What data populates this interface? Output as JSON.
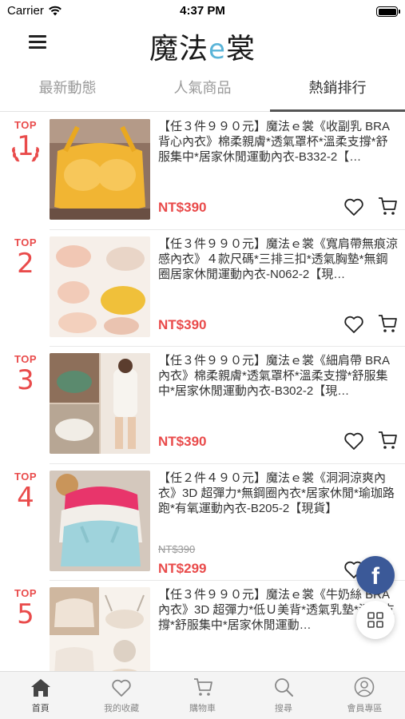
{
  "status_bar": {
    "carrier": "Carrier",
    "time": "4:37 PM"
  },
  "header": {
    "logo_left": "魔法",
    "logo_e": "e",
    "logo_right": "裳"
  },
  "tabs": [
    {
      "label": "最新動態",
      "active": false
    },
    {
      "label": "人氣商品",
      "active": false
    },
    {
      "label": "熱銷排行",
      "active": true
    }
  ],
  "products": [
    {
      "rank_label": "TOP",
      "rank": "1",
      "title": "【任３件９９０元】魔法ｅ裳《收副乳 BRA 背心內衣》棉柔親膚*透氣罩杯*溫柔支撐*舒服集中*居家休閒運動內衣-B332-2【…",
      "price": "NT$390",
      "old_price": ""
    },
    {
      "rank_label": "TOP",
      "rank": "2",
      "title": "【任３件９９０元】魔法ｅ裳《寬肩帶無痕涼感內衣》４款尺碼*三排三扣*透氣胸墊*無鋼圈居家休閒運動內衣-N062-2【現…",
      "price": "NT$390",
      "old_price": ""
    },
    {
      "rank_label": "TOP",
      "rank": "3",
      "title": "【任３件９９０元】魔法ｅ裳《細肩帶 BRA 內衣》棉柔親膚*透氣罩杯*溫柔支撐*舒服集中*居家休閒運動內衣-B302-2【現…",
      "price": "NT$390",
      "old_price": ""
    },
    {
      "rank_label": "TOP",
      "rank": "4",
      "title": "【任２件４９０元】魔法ｅ裳《洞洞涼爽內衣》3D 超彈力*無鋼圈內衣*居家休閒*瑜珈路跑*有氧運動內衣-B205-2【現貨】",
      "price": "NT$299",
      "old_price": "NT$390"
    },
    {
      "rank_label": "TOP",
      "rank": "5",
      "title": "【任３件９９０元】魔法ｅ裳《牛奶絲 BRA 內衣》3D 超彈力*低Ｕ美背*透氣乳墊*溫柔支撐*舒服集中*居家休閒運動…",
      "price": "",
      "old_price": ""
    }
  ],
  "floating": {
    "facebook_glyph": "f"
  },
  "bottom_nav": [
    {
      "label": "首頁",
      "icon": "home-icon",
      "active": true
    },
    {
      "label": "我的收藏",
      "icon": "heart-icon",
      "active": false
    },
    {
      "label": "購物車",
      "icon": "cart-icon",
      "active": false
    },
    {
      "label": "搜尋",
      "icon": "search-icon",
      "active": false
    },
    {
      "label": "會員專區",
      "icon": "user-icon",
      "active": false
    }
  ],
  "colors": {
    "accent": "#e94b4b",
    "facebook": "#3b5998",
    "logo_e": "#5ab4d8"
  }
}
